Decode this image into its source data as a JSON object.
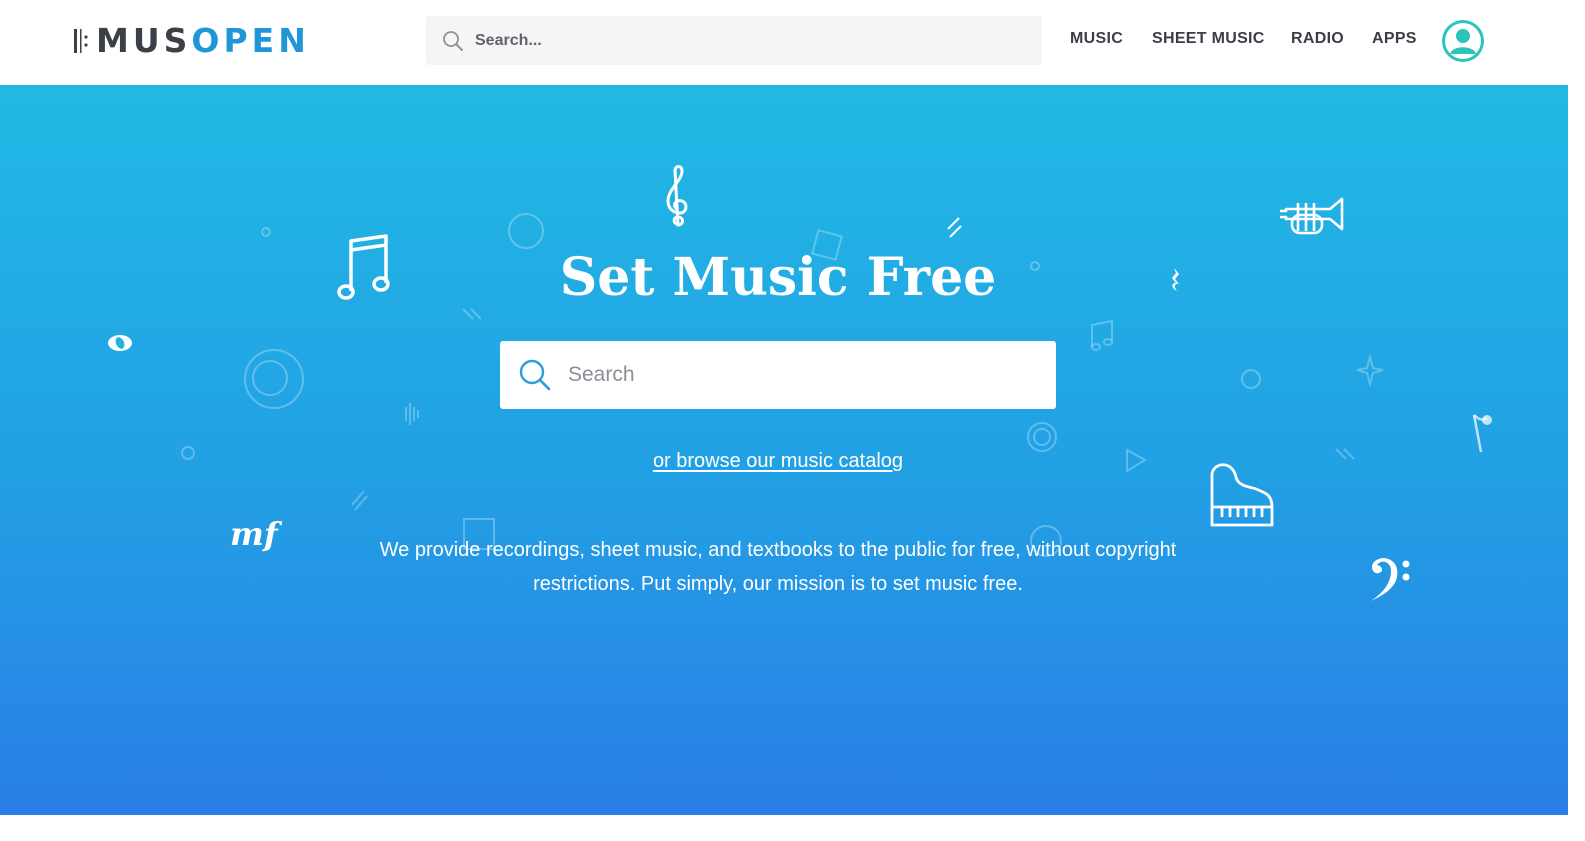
{
  "header": {
    "logo": {
      "part1": "MUS",
      "part2": "OPEN"
    },
    "search": {
      "placeholder": "Search..."
    },
    "nav": [
      {
        "label": "MUSIC"
      },
      {
        "label": "SHEET MUSIC"
      },
      {
        "label": "RADIO"
      },
      {
        "label": "APPS"
      }
    ],
    "avatar_icon": "user-avatar-icon"
  },
  "hero": {
    "title": "Set Music Free",
    "search": {
      "placeholder": "Search"
    },
    "browse_link": "or browse our music catalog",
    "description": "We provide recordings, sheet music, and textbooks to the public for free, without copyright restrictions. Put simply, our mission is to set music free.",
    "decorative_icons": [
      "treble-clef-icon",
      "beamed-notes-icon",
      "trumpet-icon",
      "piano-icon",
      "bass-clef-icon",
      "mezzo-forte-icon",
      "whole-note-icon",
      "quarter-rest-icon",
      "eighth-note-icon"
    ]
  },
  "colors": {
    "accent": "#2196d6",
    "logo_dark": "#3b3f48",
    "avatar": "#29c5bb",
    "hero_top": "#21b9e4",
    "hero_bottom": "#2a7ee6"
  }
}
